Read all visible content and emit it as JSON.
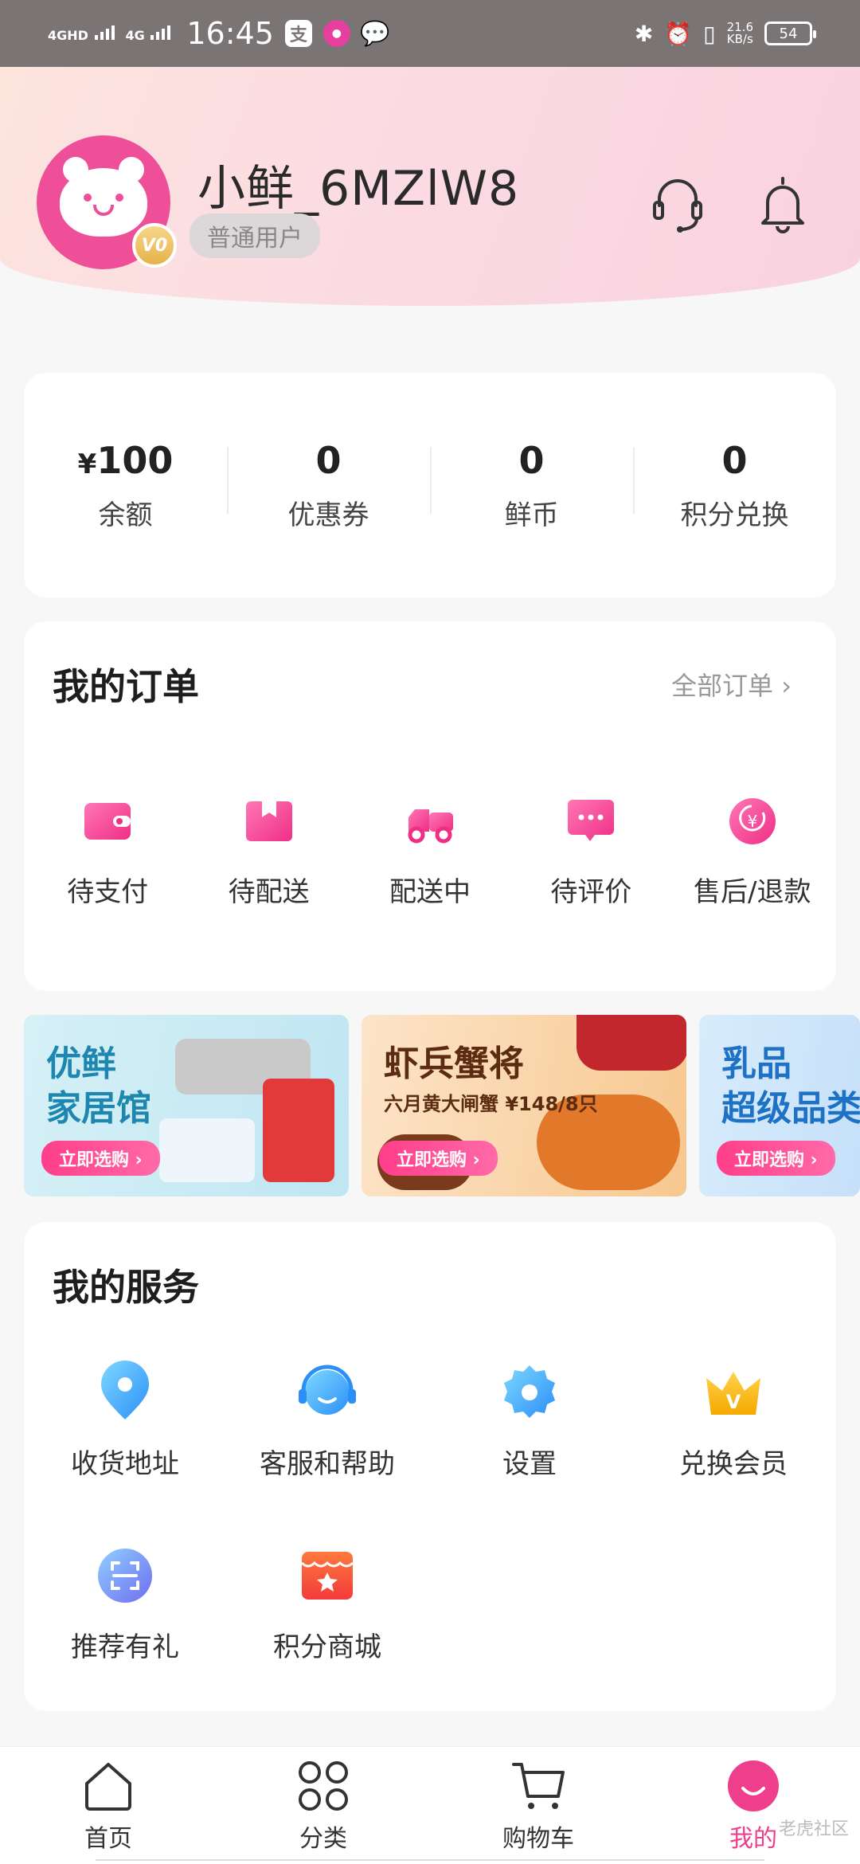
{
  "status_bar": {
    "signal1": "4GHD",
    "signal2": "4G",
    "time": "16:45",
    "app1": "支",
    "net_speed": "21.6",
    "net_unit": "KB/s",
    "battery": "54"
  },
  "header": {
    "username": "小鲜_6MZlW8",
    "user_tag": "普通用户",
    "level": "V0"
  },
  "assets": [
    {
      "value": "100",
      "prefix": "¥",
      "label": "余额"
    },
    {
      "value": "0",
      "prefix": "",
      "label": "优惠券"
    },
    {
      "value": "0",
      "prefix": "",
      "label": "鲜币"
    },
    {
      "value": "0",
      "prefix": "",
      "label": "积分兑换"
    }
  ],
  "orders": {
    "title": "我的订单",
    "all_label": "全部订单",
    "items": [
      {
        "label": "待支付",
        "icon": "wallet-icon"
      },
      {
        "label": "待配送",
        "icon": "package-icon"
      },
      {
        "label": "配送中",
        "icon": "delivery-scooter-icon"
      },
      {
        "label": "待评价",
        "icon": "comment-icon"
      },
      {
        "label": "售后/退款",
        "icon": "refund-icon"
      }
    ]
  },
  "banners": [
    {
      "title_line1": "优鲜",
      "title_line2": "家居馆",
      "subtitle": "",
      "button": "立即选购"
    },
    {
      "title_line1": "虾兵蟹将",
      "title_line2": "",
      "subtitle": "六月黄大闸蟹 ¥148/8只",
      "button": "立即选购"
    },
    {
      "title_line1": "乳品",
      "title_line2": "超级品类",
      "subtitle": "",
      "button": "立即选购"
    }
  ],
  "services": {
    "title": "我的服务",
    "items": [
      {
        "label": "收货地址",
        "icon": "location-pin-icon"
      },
      {
        "label": "客服和帮助",
        "icon": "customer-service-icon"
      },
      {
        "label": "设置",
        "icon": "gear-icon"
      },
      {
        "label": "兑换会员",
        "icon": "crown-icon"
      },
      {
        "label": "推荐有礼",
        "icon": "scan-icon"
      },
      {
        "label": "积分商城",
        "icon": "store-icon"
      }
    ]
  },
  "tabbar": [
    {
      "label": "首页",
      "icon": "home-icon"
    },
    {
      "label": "分类",
      "icon": "category-grid-icon"
    },
    {
      "label": "购物车",
      "icon": "cart-icon"
    },
    {
      "label": "我的",
      "icon": "profile-smile-icon",
      "active": true
    }
  ],
  "watermark": "老虎社区",
  "colors": {
    "accent": "#ef3f8c",
    "header_gradient_start": "#fde4dd",
    "header_gradient_end": "#f9d2e0"
  }
}
